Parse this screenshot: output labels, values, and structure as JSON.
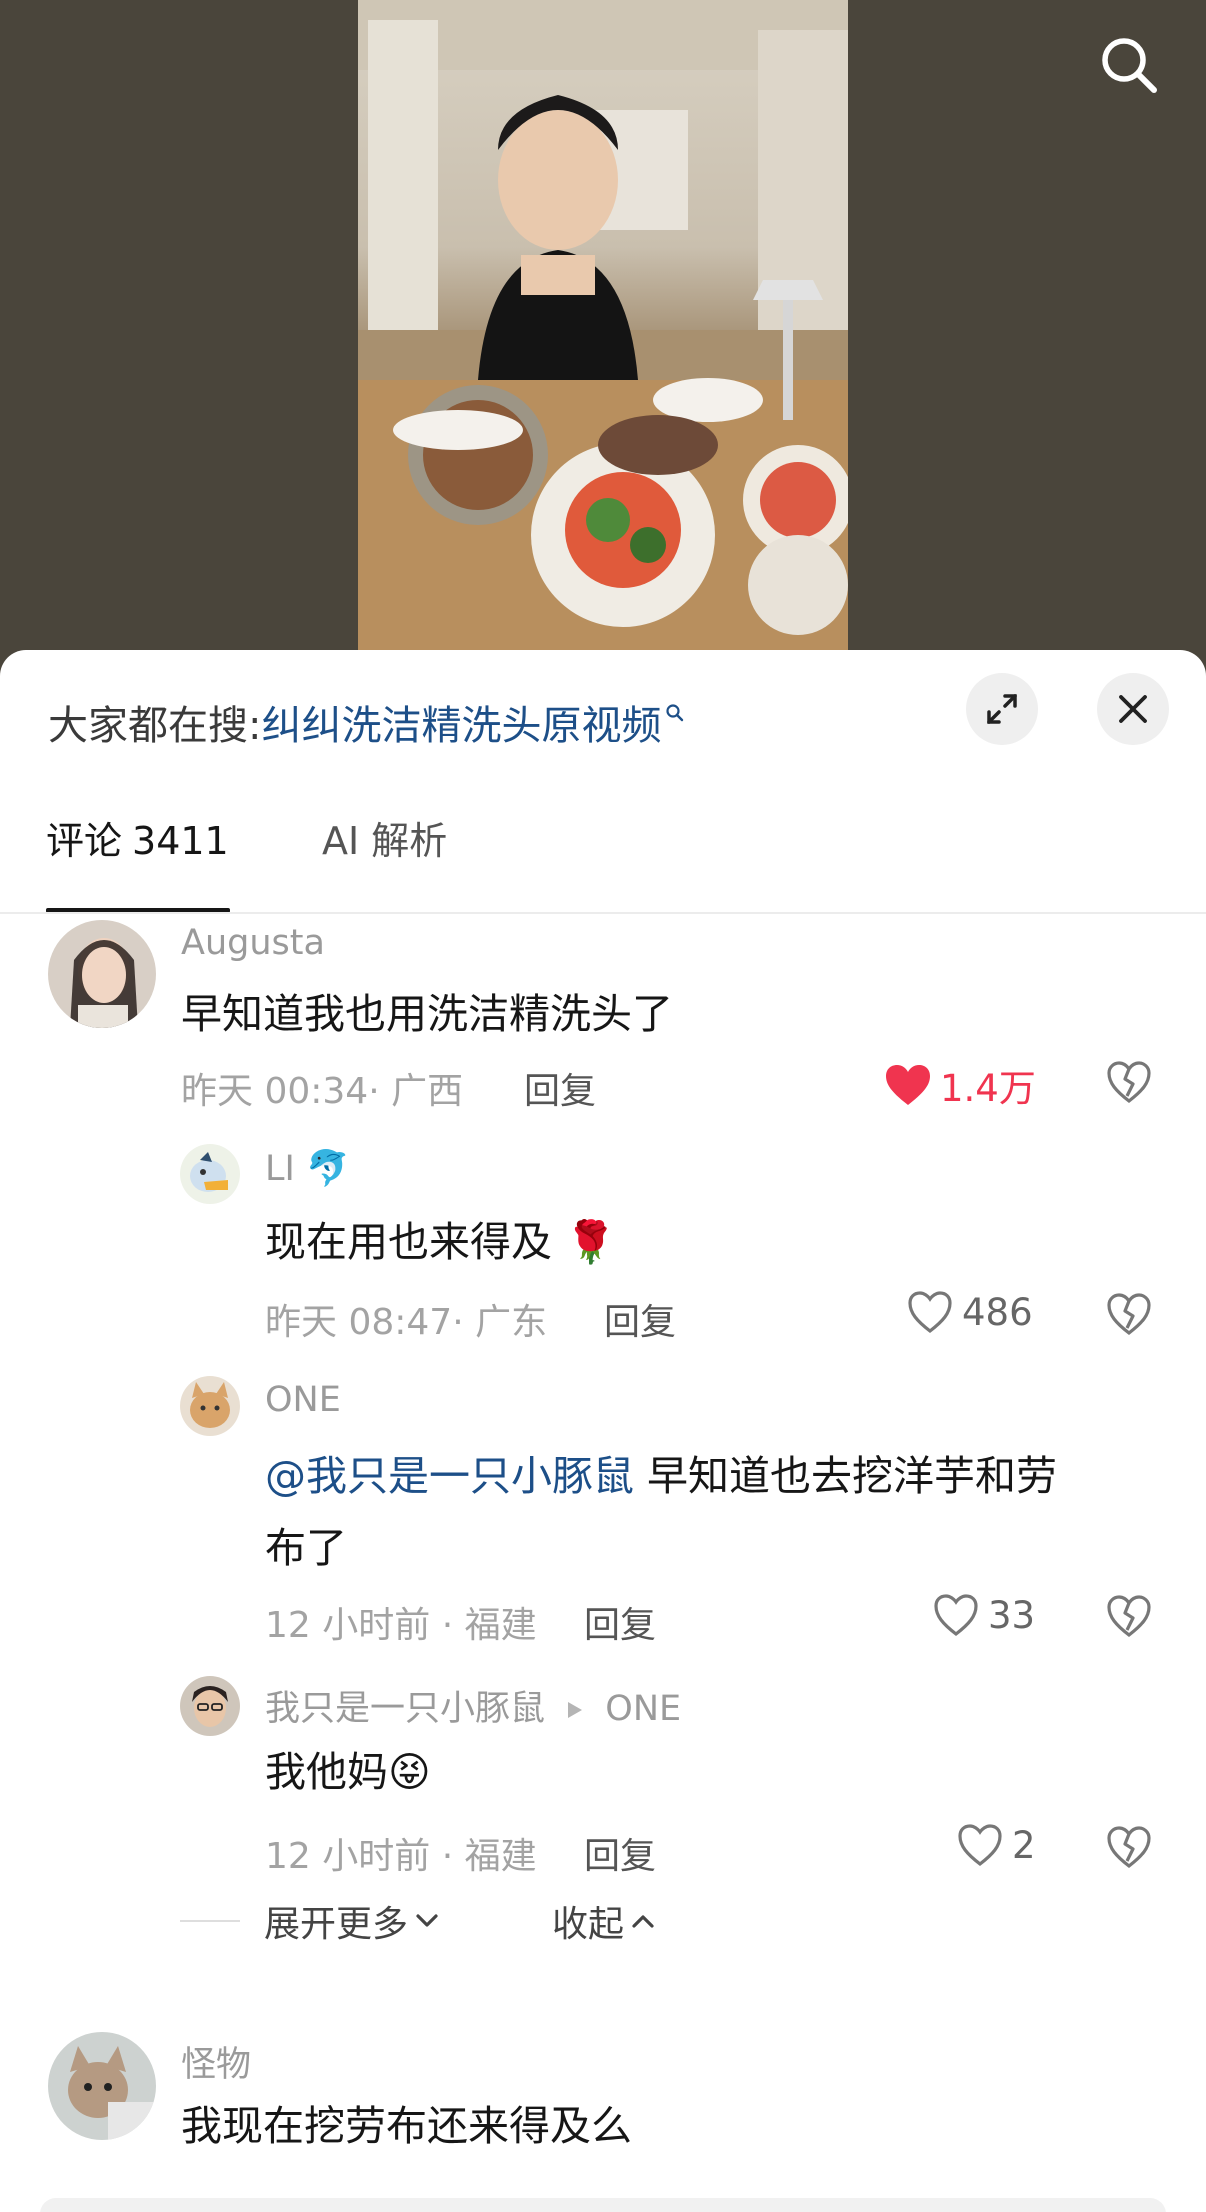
{
  "video": {
    "search_icon": "search-icon"
  },
  "hot_search": {
    "prefix": "大家都在搜:",
    "term": "纠纠洗洁精洗头原视频"
  },
  "tabs": [
    {
      "label": "评论",
      "count": "3411",
      "active": true
    },
    {
      "label": "AI 解析",
      "active": false
    }
  ],
  "comments": [
    {
      "user": "Augusta",
      "text": "早知道我也用洗洁精洗头了",
      "time": "昨天 00:34",
      "location": "广西",
      "reply": "回复",
      "likes": "1.4万",
      "liked": true
    },
    {
      "user": "LI",
      "user_emoji": "🐬",
      "text": "现在用也来得及",
      "text_emoji": "🌹",
      "time": "昨天 08:47",
      "location": "广东",
      "reply": "回复",
      "likes": "486"
    },
    {
      "user": "ONE",
      "mention": "@我只是一只小豚鼠",
      "text_line1": "早知道也去挖洋芋和劳",
      "text_line2": "布了",
      "time": "12 小时前",
      "location": "福建",
      "reply": "回复",
      "likes": "33"
    },
    {
      "user": "我只是一只小豚鼠",
      "reply_to": "ONE",
      "text": "我他妈",
      "text_emoji": "😝",
      "time": "12 小时前",
      "location": "福建",
      "reply": "回复",
      "likes": "2"
    },
    {
      "user": "怪物",
      "text": "我现在挖劳布还来得及么"
    }
  ],
  "thread_controls": {
    "expand": "展开更多",
    "collapse": "收起"
  },
  "colors": {
    "like_active": "#f0344f",
    "link": "#1d4f88",
    "text": "#161616",
    "muted": "#a3a3a3"
  }
}
